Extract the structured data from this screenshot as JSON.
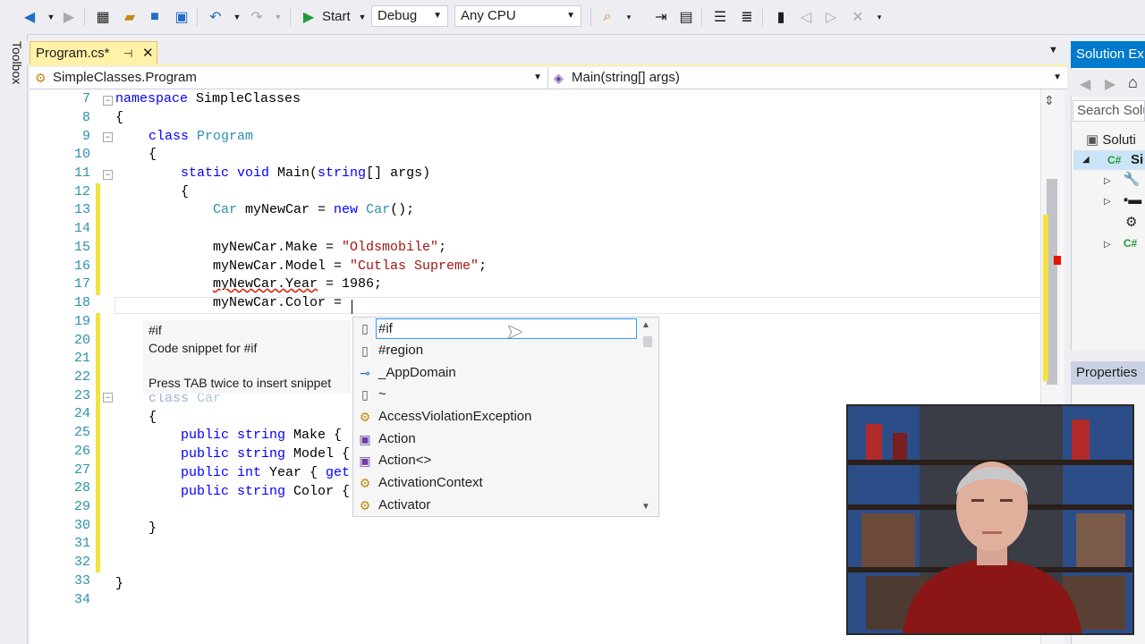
{
  "toolbar": {
    "start_label": "Start",
    "config_value": "Debug",
    "platform_value": "Any CPU"
  },
  "toolbox_label": "Toolbox",
  "tab": {
    "title": "Program.cs*"
  },
  "navbar": {
    "type_scope": "SimpleClasses.Program",
    "member_scope": "Main(string[] args)"
  },
  "editor": {
    "line_numbers": [
      "7",
      "8",
      "9",
      "10",
      "11",
      "12",
      "13",
      "14",
      "15",
      "16",
      "17",
      "18",
      "19",
      "20",
      "21",
      "22",
      "23",
      "24",
      "25",
      "26",
      "27",
      "28",
      "29",
      "30",
      "31",
      "32",
      "33",
      "34"
    ],
    "lines": {
      "l7_kw": "namespace",
      "l7_rest": " SimpleClasses",
      "l8": "{",
      "l9_kw": "class",
      "l9_ty": "Program",
      "l10": "{",
      "l11_kw": "static void",
      "l11_rest": " Main(",
      "l11_kw2": "string",
      "l11_rest2": "[] args)",
      "l12": "{",
      "l13_ty": "Car",
      "l13_a": " myNewCar = ",
      "l13_kw": "new",
      "l13_ty2": " Car",
      "l13_b": "();",
      "l15_a": "myNewCar.Make = ",
      "l15_s": "\"Oldsmobile\"",
      "l15_b": ";",
      "l16_a": "myNewCar.Model = ",
      "l16_s": "\"Cutlas Supreme\"",
      "l16_b": ";",
      "l17_sq": "myNewCar.Year",
      "l17_b": " = 1986;",
      "l18": "myNewCar.Color = ",
      "l23_kw": "class",
      "l23_ty": "Car",
      "l24": "{",
      "l25_kw": "public string",
      "l25_rest": " Make {",
      "l26_kw": "public string",
      "l26_rest": " Model {",
      "l27_kw": "public int",
      "l27_rest": " Year { ",
      "l27_kw2": "get",
      "l28_kw": "public string",
      "l28_rest": " Color {",
      "l30": "}",
      "l33": "}"
    }
  },
  "tooltip": {
    "title": "#if",
    "desc": "Code snippet for #if",
    "hint": "Press TAB twice to insert snippet"
  },
  "completion": {
    "items": [
      {
        "label": "#if",
        "icon": "snippet-icon"
      },
      {
        "label": "#region",
        "icon": "snippet-icon"
      },
      {
        "label": "_AppDomain",
        "icon": "interface-icon"
      },
      {
        "label": "~",
        "icon": "snippet-icon"
      },
      {
        "label": "AccessViolationException",
        "icon": "class-icon"
      },
      {
        "label": "Action",
        "icon": "delegate-icon"
      },
      {
        "label": "Action<>",
        "icon": "delegate-icon"
      },
      {
        "label": "ActivationContext",
        "icon": "class-icon"
      },
      {
        "label": "Activator",
        "icon": "class-icon"
      }
    ]
  },
  "solution_explorer": {
    "title": "Solution Ex",
    "search_placeholder": "Search Solu",
    "solution_row": "Soluti",
    "project_row": "Si"
  },
  "properties": {
    "title": "Properties"
  },
  "colors": {
    "accent": "#007acc",
    "tab_active": "#fff1a8",
    "keyword": "#0000ff",
    "type": "#2b91af",
    "string": "#a31515",
    "line_number": "#2b91af"
  }
}
